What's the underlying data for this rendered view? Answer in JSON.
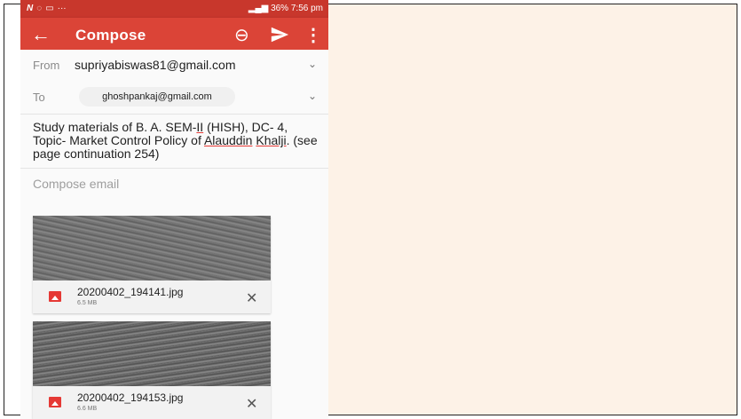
{
  "status_bar": {
    "left_icons": [
      "N",
      "whatsapp",
      "gallery",
      "..."
    ],
    "right_text": "36% 7:56 pm",
    "battery_percent": "36%",
    "time": "7:56 pm"
  },
  "app_bar": {
    "title": "Compose",
    "icons": [
      "back-arrow",
      "attach",
      "send",
      "more-vert"
    ],
    "color": "#db4437"
  },
  "from": {
    "label": "From",
    "value": "supriyabiswas81@gmail.com"
  },
  "to": {
    "label": "To",
    "chip": "ghoshpankaj@gmail.com"
  },
  "subject": {
    "part1": "Study materials of B. A. SEM-",
    "sem": "II",
    "part2": " (HISH), DC- 4, Topic- Market Control Policy of ",
    "name1": "Alauddin",
    "space": " ",
    "name2": "Khalji",
    "part3": ". (see page continuation 254)"
  },
  "body": {
    "placeholder": "Compose email"
  },
  "attachments": [
    {
      "name": "20200402_194141.jpg",
      "size": "6.5 MB"
    },
    {
      "name": "20200402_194153.jpg",
      "size": "6.6 MB"
    }
  ]
}
